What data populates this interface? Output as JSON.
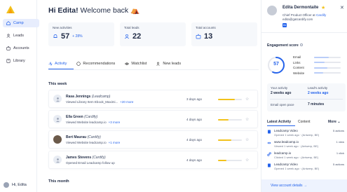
{
  "sidebar": {
    "items": [
      {
        "label": "Camp",
        "icon": "home-icon",
        "active": true
      },
      {
        "label": "Leads",
        "icon": "users-icon",
        "active": false
      },
      {
        "label": "Accounts",
        "icon": "accounts-icon",
        "active": false
      },
      {
        "label": "Library",
        "icon": "library-icon",
        "active": false
      }
    ],
    "user_label": "Hi, Edita"
  },
  "greeting": {
    "name": "Hi Edita!",
    "rest": "Welcome back",
    "emoji": "⛺"
  },
  "stats": [
    {
      "label": "New activities",
      "value": "57",
      "delta": "+ 28%"
    },
    {
      "label": "Total leads",
      "value": "22",
      "delta": ""
    },
    {
      "label": "Total accounts",
      "value": "13",
      "delta": ""
    }
  ],
  "tabs": [
    {
      "label": "Activity",
      "active": true
    },
    {
      "label": "Recommendations",
      "active": false
    },
    {
      "label": "Watchlist",
      "active": false
    },
    {
      "label": "New leads",
      "active": false
    }
  ],
  "sections": {
    "this_week": "This week",
    "this_month": "This month"
  },
  "activities": [
    {
      "name": "Rasa Jennings",
      "company": "(Leadcamp)",
      "detail": "Viewed Library Item Ebook_Maximi...",
      "more": "+20 more",
      "when": "3 days ago",
      "score": 0.7
    },
    {
      "name": "Ella Green",
      "company": "(Cardify)",
      "detail": "Viewed Website leadcamp.io",
      "more": "+3 more",
      "when": "4 days ago",
      "score": 0.45
    },
    {
      "name": "Bert Maurau",
      "company": "(Cardify)",
      "detail": "Viewed Website leadcamp.io",
      "more": "+1 more",
      "when": "4 days ago",
      "score": 0.55
    },
    {
      "name": "James Stevens",
      "company": "(Cardify)",
      "detail": "Opened Email Leadcamp follow up",
      "more": "",
      "when": "4 days ago",
      "score": 0.35
    }
  ],
  "panel": {
    "name": "Edita Dermontaite",
    "role_prefix": "Chief Product Officer at",
    "company": "Cardify",
    "email": "edita@gatcardify.com",
    "linkedin": "in",
    "engagement_title": "Engagement score",
    "engagement_value": "57",
    "engagement_fraction": 0.57,
    "engagement_rows": [
      {
        "label": "Email",
        "fraction": 0.55
      },
      {
        "label": "Links",
        "fraction": 0.4
      },
      {
        "label": "Content",
        "fraction": 0.5
      },
      {
        "label": "Website",
        "fraction": 0.35
      }
    ],
    "metrics": {
      "your_activity_label": "Your activity",
      "your_activity_value": "2 weeks ago",
      "leads_activity_label": "Lead's activity",
      "leads_activity_value": "2 weeks ago",
      "email_open_label": "Email open pace",
      "email_open_value": "7 minutes"
    },
    "tabs": [
      {
        "label": "Latest Activity",
        "active": true
      },
      {
        "label": "Content",
        "active": false
      }
    ],
    "more_label": "More",
    "items": [
      {
        "icon": "file-icon",
        "title": "Leadcamp Video",
        "sub": "Opened 1 week ago · (Antwerp, BE)",
        "count": "5 actions"
      },
      {
        "icon": "eye-icon",
        "title": "www.leadcamp.io",
        "sub": "Viewed 1 week ago · (Antwerp, BE)",
        "count": "1 view"
      },
      {
        "icon": "link-icon",
        "title": "leadcamp.io",
        "sub": "Clicked 1 week ago · (Antwerp, BE)",
        "count": "1 click"
      },
      {
        "icon": "file-icon",
        "title": "Leadcamp Video",
        "sub": "Opened 1 week ago · (Antwerp, BE)",
        "count": "5 actions"
      }
    ],
    "view_all": "View account details →"
  },
  "colors": {
    "accent": "#2563eb",
    "yellow": "#f2c21c",
    "light_bg": "#f6f8fb"
  }
}
